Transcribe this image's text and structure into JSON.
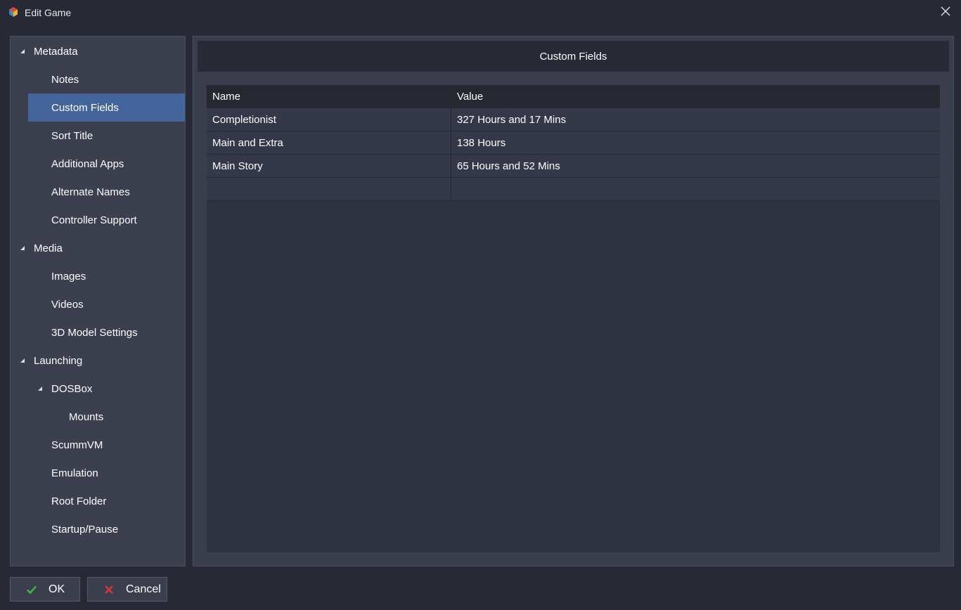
{
  "window": {
    "title": "Edit Game",
    "icon": "app-cube-icon",
    "close_icon": "close-icon"
  },
  "sidebar": {
    "items": [
      {
        "label": "Metadata",
        "level": 0,
        "expandable": true,
        "selected": false
      },
      {
        "label": "Notes",
        "level": 1,
        "expandable": false,
        "selected": false
      },
      {
        "label": "Custom Fields",
        "level": 1,
        "expandable": false,
        "selected": true
      },
      {
        "label": "Sort Title",
        "level": 1,
        "expandable": false,
        "selected": false
      },
      {
        "label": "Additional Apps",
        "level": 1,
        "expandable": false,
        "selected": false
      },
      {
        "label": "Alternate Names",
        "level": 1,
        "expandable": false,
        "selected": false
      },
      {
        "label": "Controller Support",
        "level": 1,
        "expandable": false,
        "selected": false
      },
      {
        "label": "Media",
        "level": 0,
        "expandable": true,
        "selected": false
      },
      {
        "label": "Images",
        "level": 1,
        "expandable": false,
        "selected": false
      },
      {
        "label": "Videos",
        "level": 1,
        "expandable": false,
        "selected": false
      },
      {
        "label": "3D Model Settings",
        "level": 1,
        "expandable": false,
        "selected": false
      },
      {
        "label": "Launching",
        "level": 0,
        "expandable": true,
        "selected": false
      },
      {
        "label": "DOSBox",
        "level": 1,
        "expandable": true,
        "selected": false
      },
      {
        "label": "Mounts",
        "level": 2,
        "expandable": false,
        "selected": false
      },
      {
        "label": "ScummVM",
        "level": 1,
        "expandable": false,
        "selected": false
      },
      {
        "label": "Emulation",
        "level": 1,
        "expandable": false,
        "selected": false
      },
      {
        "label": "Root Folder",
        "level": 1,
        "expandable": false,
        "selected": false
      },
      {
        "label": "Startup/Pause",
        "level": 1,
        "expandable": false,
        "selected": false
      }
    ]
  },
  "main": {
    "title": "Custom Fields",
    "table": {
      "columns": [
        "Name",
        "Value"
      ],
      "rows": [
        [
          "Completionist",
          "327 Hours and 17 Mins"
        ],
        [
          "Main and Extra",
          "138 Hours"
        ],
        [
          "Main Story",
          "65 Hours and 52 Mins"
        ],
        [
          "",
          ""
        ]
      ]
    }
  },
  "footer": {
    "ok_label": "OK",
    "ok_icon": "checkmark-icon",
    "cancel_label": "Cancel",
    "cancel_icon": "cancel-x-icon"
  },
  "colors": {
    "background": "#272935",
    "panel": "#3b3f4e",
    "selection": "#44659c",
    "ok_green": "#3fbf3f",
    "cancel_red": "#d23a3a"
  }
}
